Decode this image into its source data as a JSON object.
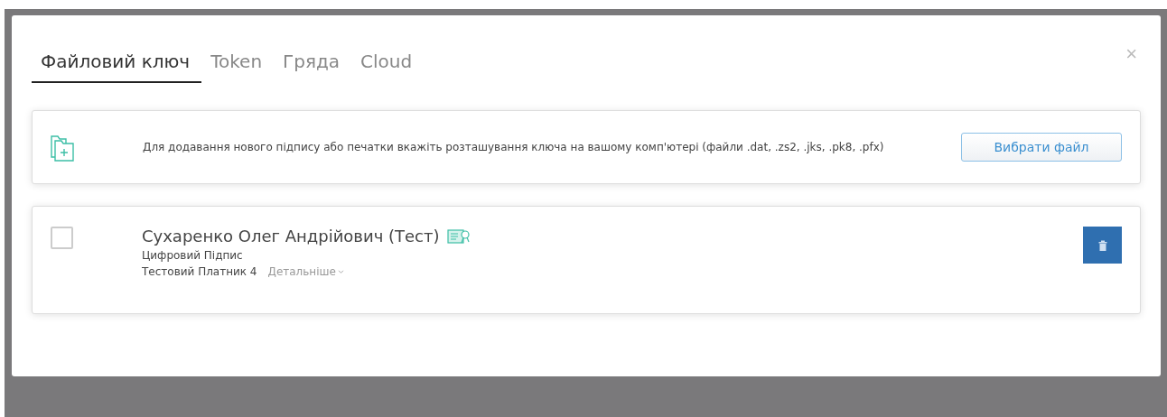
{
  "dialog": {
    "close": "×",
    "tabs": [
      {
        "label": "Файловий ключ",
        "selected": true
      },
      {
        "label": "Token",
        "selected": false
      },
      {
        "label": "Гряда",
        "selected": false
      },
      {
        "label": "Cloud",
        "selected": false
      }
    ],
    "file_panel": {
      "text": "Для додавання нового підпису або печатки вкажіть розташування ключа на вашому комп'ютері (файли .dat, .zs2, .jks, .pk8, .pfx)",
      "button": "Вибрати файл"
    },
    "keys": [
      {
        "name": "Сухаренко Олег Андрійович (Тест)",
        "type": "Цифровий Підпис",
        "owner": "Тестовий Платник 4",
        "details": "Детальніше",
        "checked": false
      }
    ]
  }
}
